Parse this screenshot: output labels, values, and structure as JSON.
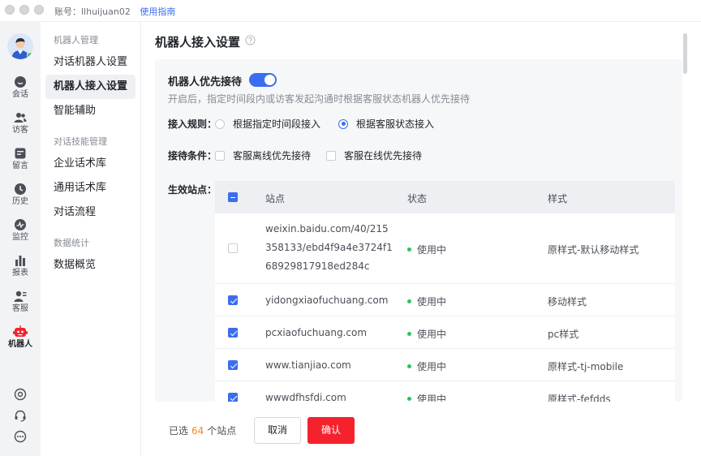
{
  "header": {
    "account_label": "账号：llhuijuan02",
    "guide_link": "使用指南"
  },
  "rail": {
    "items": [
      {
        "label": "会话",
        "icon": "chat-icon"
      },
      {
        "label": "访客",
        "icon": "visitors-icon"
      },
      {
        "label": "留言",
        "icon": "message-icon"
      },
      {
        "label": "历史",
        "icon": "history-icon"
      },
      {
        "label": "监控",
        "icon": "monitor-icon"
      },
      {
        "label": "报表",
        "icon": "report-icon"
      },
      {
        "label": "客服",
        "icon": "agent-icon"
      },
      {
        "label": "机器人",
        "icon": "robot-icon",
        "active": true
      }
    ],
    "bottom_icons": [
      "settings-icon",
      "headset-icon",
      "more-icon"
    ]
  },
  "nav": {
    "groups": [
      {
        "title": "机器人管理",
        "items": [
          "对话机器人设置",
          "机器人接入设置",
          "智能辅助"
        ]
      },
      {
        "title": "对话技能管理",
        "items": [
          "企业话术库",
          "通用话术库",
          "对话流程"
        ]
      },
      {
        "title": "数据统计",
        "items": [
          "数据概览"
        ]
      }
    ],
    "active_item": "机器人接入设置"
  },
  "main": {
    "title": "机器人接入设置",
    "priority": {
      "title": "机器人优先接待",
      "enabled": true,
      "description": "开启后，指定时间段内或访客发起沟通时根据客服状态机器人优先接待"
    },
    "rule": {
      "label": "接入规则：",
      "options": [
        "根据指定时间段接入",
        "根据客服状态接入"
      ],
      "selected_index": 1
    },
    "condition": {
      "label": "接待条件：",
      "options": [
        "客服离线优先接待",
        "客服在线优先接待"
      ]
    },
    "sites": {
      "label": "生效站点：",
      "columns": [
        "站点",
        "状态",
        "样式"
      ],
      "rows": [
        {
          "site_lines": [
            "weixin.baidu.com/40/215",
            "358133/ebd4f9a4e3724f1",
            "68929817918ed284c"
          ],
          "status": "使用中",
          "style": "原样式-默认移动样式",
          "checked": false
        },
        {
          "site_lines": [
            "yidongxiaofuchuang.com"
          ],
          "status": "使用中",
          "style": "移动样式",
          "checked": true
        },
        {
          "site_lines": [
            "pcxiaofuchuang.com"
          ],
          "status": "使用中",
          "style": "pc样式",
          "checked": true
        },
        {
          "site_lines": [
            "www.tianjiao.com"
          ],
          "status": "使用中",
          "style": "原样式-tj-mobile",
          "checked": true
        },
        {
          "site_lines": [
            "wwwdfhsfdi.com"
          ],
          "status": "使用中",
          "style": "原样式-fefdds",
          "checked": true
        }
      ]
    }
  },
  "footer": {
    "selected_prefix": "已选",
    "selected_count": "64",
    "selected_suffix": "个站点",
    "cancel_label": "取消",
    "confirm_label": "确认"
  },
  "colors": {
    "accent": "#3b6df0",
    "confirm": "#f5222d",
    "count": "#f08a24",
    "status_ok": "#2fc25b"
  }
}
